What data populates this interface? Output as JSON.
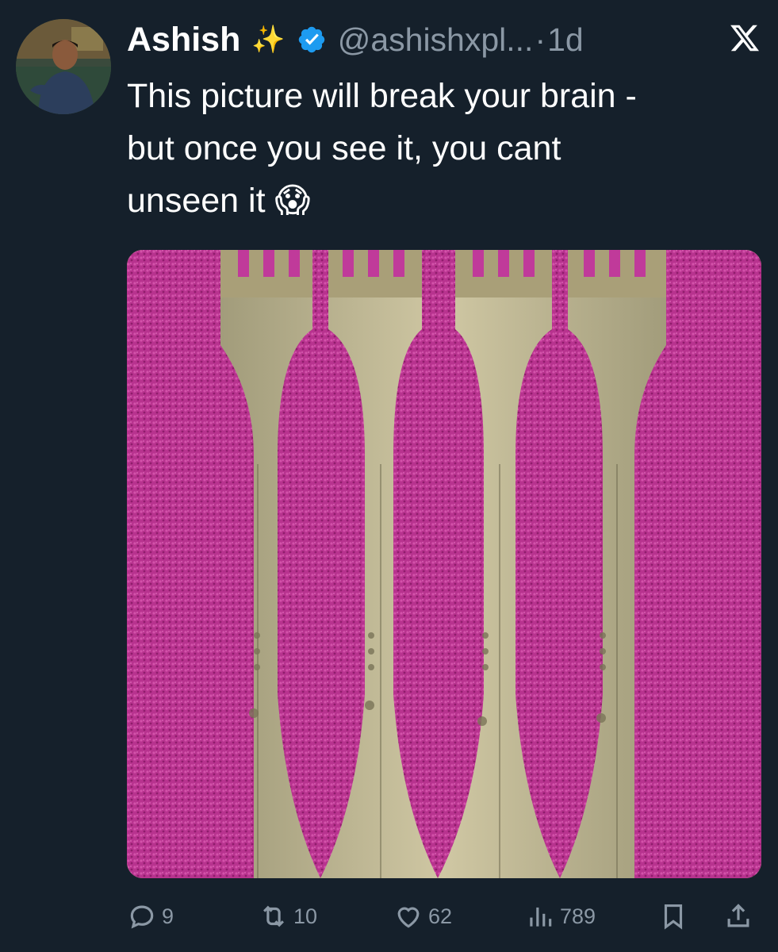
{
  "author": {
    "display_name": "Ashish",
    "sparkle_emoji": "✨",
    "handle": "@ashishxpl...",
    "separator": "·",
    "time": "1d",
    "verified_icon": "verified-badge-icon",
    "avatar_icon": "avatar"
  },
  "tweet": {
    "text_line1": "This picture will break your brain -",
    "text_line2": "but once you see it, you cant",
    "text_line3": "unseen it 😱"
  },
  "actions": {
    "replies": "9",
    "retweets": "10",
    "likes": "62",
    "views": "789"
  },
  "colors": {
    "background": "#15202b",
    "text": "#ffffff",
    "muted": "#8b98a5",
    "verified_blue": "#1d9bf0",
    "towel_magenta": "#b02a8c",
    "metal": "#b8ad85"
  }
}
